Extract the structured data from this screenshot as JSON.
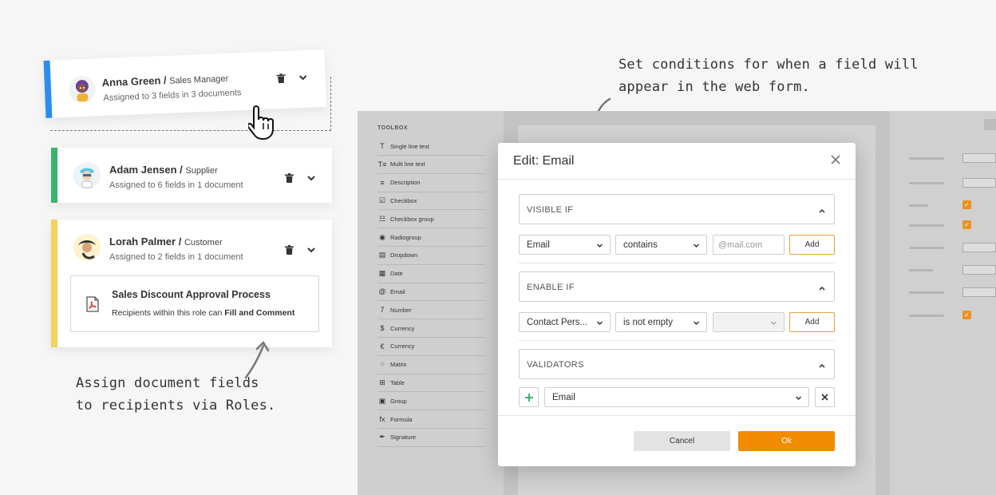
{
  "roles": [
    {
      "name": "Anna Green",
      "role": "Sales Manager",
      "assigned": "Assigned to 3 fields in 3 documents",
      "color": "#2d8cf0"
    },
    {
      "name": "Adam Jensen",
      "role": "Supplier",
      "assigned": "Assigned to 6 fields in 1 document",
      "color": "#3bb36b"
    },
    {
      "name": "Lorah Palmer",
      "role": "Customer",
      "assigned": "Assigned to 2 fields in 1 document",
      "color": "#f4d35e"
    }
  ],
  "document": {
    "title": "Sales Discount Approval Process",
    "subtitle_prefix": "Recipients within this role can",
    "permission": "Fill and Comment"
  },
  "annotations": {
    "roles_line1": "Assign document fields",
    "roles_line2": "to recipients via Roles.",
    "conditions_line1": "Set conditions for when a field will",
    "conditions_line2": "appear in the web form."
  },
  "toolbox": {
    "title": "TOOLBOX",
    "items": [
      {
        "label": "Single line text",
        "icon": "T"
      },
      {
        "label": "Multi line text",
        "icon": "T≡"
      },
      {
        "label": "Description",
        "icon": "≡"
      },
      {
        "label": "Checkbox",
        "icon": "☑"
      },
      {
        "label": "Checkbox group",
        "icon": "☷"
      },
      {
        "label": "Radiogroup",
        "icon": "◉"
      },
      {
        "label": "Dropdown",
        "icon": "▤"
      },
      {
        "label": "Date",
        "icon": "▦"
      },
      {
        "label": "Email",
        "icon": "@"
      },
      {
        "label": "Number",
        "icon": "7"
      },
      {
        "label": "Currency",
        "icon": "$"
      },
      {
        "label": "Currency",
        "icon": "€"
      },
      {
        "label": "Matrix",
        "icon": "⁘"
      },
      {
        "label": "Table",
        "icon": "⊞"
      },
      {
        "label": "Group",
        "icon": "▣"
      },
      {
        "label": "Formula",
        "icon": "fx"
      },
      {
        "label": "Signature",
        "icon": "✒"
      }
    ]
  },
  "modal": {
    "title": "Edit: Email",
    "visible_if": {
      "label": "VISIBLE IF",
      "field": "Email",
      "operator": "contains",
      "value_placeholder": "@mail.com",
      "add": "Add"
    },
    "enable_if": {
      "label": "ENABLE IF",
      "field": "Contact Pers...",
      "operator": "is not empty",
      "value": "",
      "add": "Add"
    },
    "validators": {
      "label": "VALIDATORS",
      "type": "Email"
    },
    "cancel": "Cancel",
    "ok": "Ok"
  },
  "colors": {
    "accent": "#f28c00",
    "anna": "#2d8cf0",
    "adam": "#3bb36b",
    "lorah": "#f4d35e"
  }
}
